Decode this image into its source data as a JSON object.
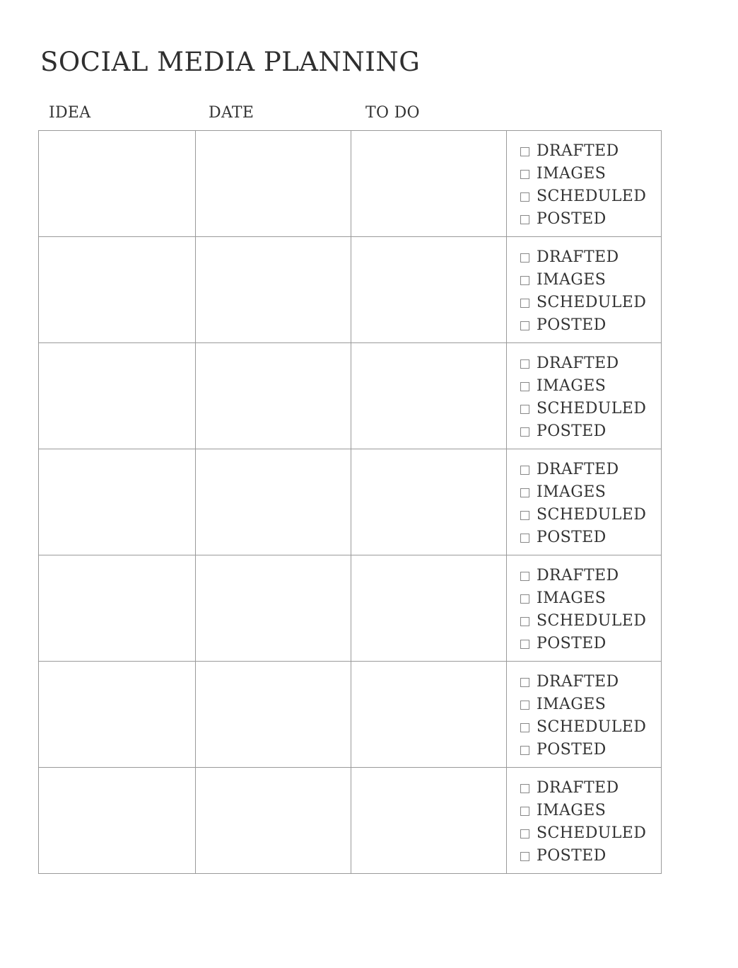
{
  "document": {
    "title": "SOCIAL MEDIA PLANNING"
  },
  "columns": {
    "idea": "IDEA",
    "date": "DATE",
    "todo": "TO DO"
  },
  "checklist_labels": [
    "DRAFTED",
    "IMAGES",
    "SCHEDULED",
    "POSTED"
  ],
  "rows": [
    {
      "idea": "",
      "date": "",
      "todo": "",
      "checks": [
        false,
        false,
        false,
        false
      ]
    },
    {
      "idea": "",
      "date": "",
      "todo": "",
      "checks": [
        false,
        false,
        false,
        false
      ]
    },
    {
      "idea": "",
      "date": "",
      "todo": "",
      "checks": [
        false,
        false,
        false,
        false
      ]
    },
    {
      "idea": "",
      "date": "",
      "todo": "",
      "checks": [
        false,
        false,
        false,
        false
      ]
    },
    {
      "idea": "",
      "date": "",
      "todo": "",
      "checks": [
        false,
        false,
        false,
        false
      ]
    },
    {
      "idea": "",
      "date": "",
      "todo": "",
      "checks": [
        false,
        false,
        false,
        false
      ]
    },
    {
      "idea": "",
      "date": "",
      "todo": "",
      "checks": [
        false,
        false,
        false,
        false
      ]
    }
  ],
  "colors": {
    "text": "#333333",
    "border": "#9a9a9a",
    "background": "#ffffff"
  }
}
